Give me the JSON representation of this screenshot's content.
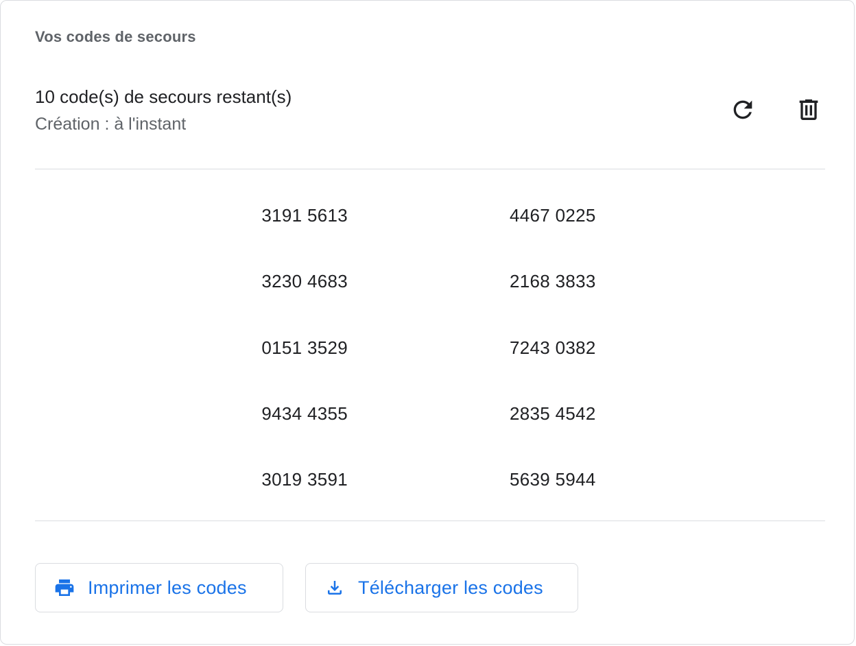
{
  "section_title": "Vos codes de secours",
  "status": {
    "remaining_text": "10 code(s) de secours restant(s)",
    "created_text": "Création : à l'instant"
  },
  "actions": {
    "refresh_icon": "refresh-icon",
    "delete_icon": "trash-icon"
  },
  "codes": [
    {
      "left": "3191 5613",
      "right": "4467 0225"
    },
    {
      "left": "3230 4683",
      "right": "2168 3833"
    },
    {
      "left": "0151 3529",
      "right": "7243 0382"
    },
    {
      "left": "9434 4355",
      "right": "2835 4542"
    },
    {
      "left": "3019 3591",
      "right": "5639 5944"
    }
  ],
  "buttons": {
    "print": {
      "label": "Imprimer les codes",
      "icon": "printer-icon"
    },
    "download": {
      "label": "Télécharger les codes",
      "icon": "download-icon"
    }
  },
  "colors": {
    "accent": "#1a73e8",
    "text_primary": "#202124",
    "text_secondary": "#5f6368",
    "divider": "#dadce0"
  }
}
